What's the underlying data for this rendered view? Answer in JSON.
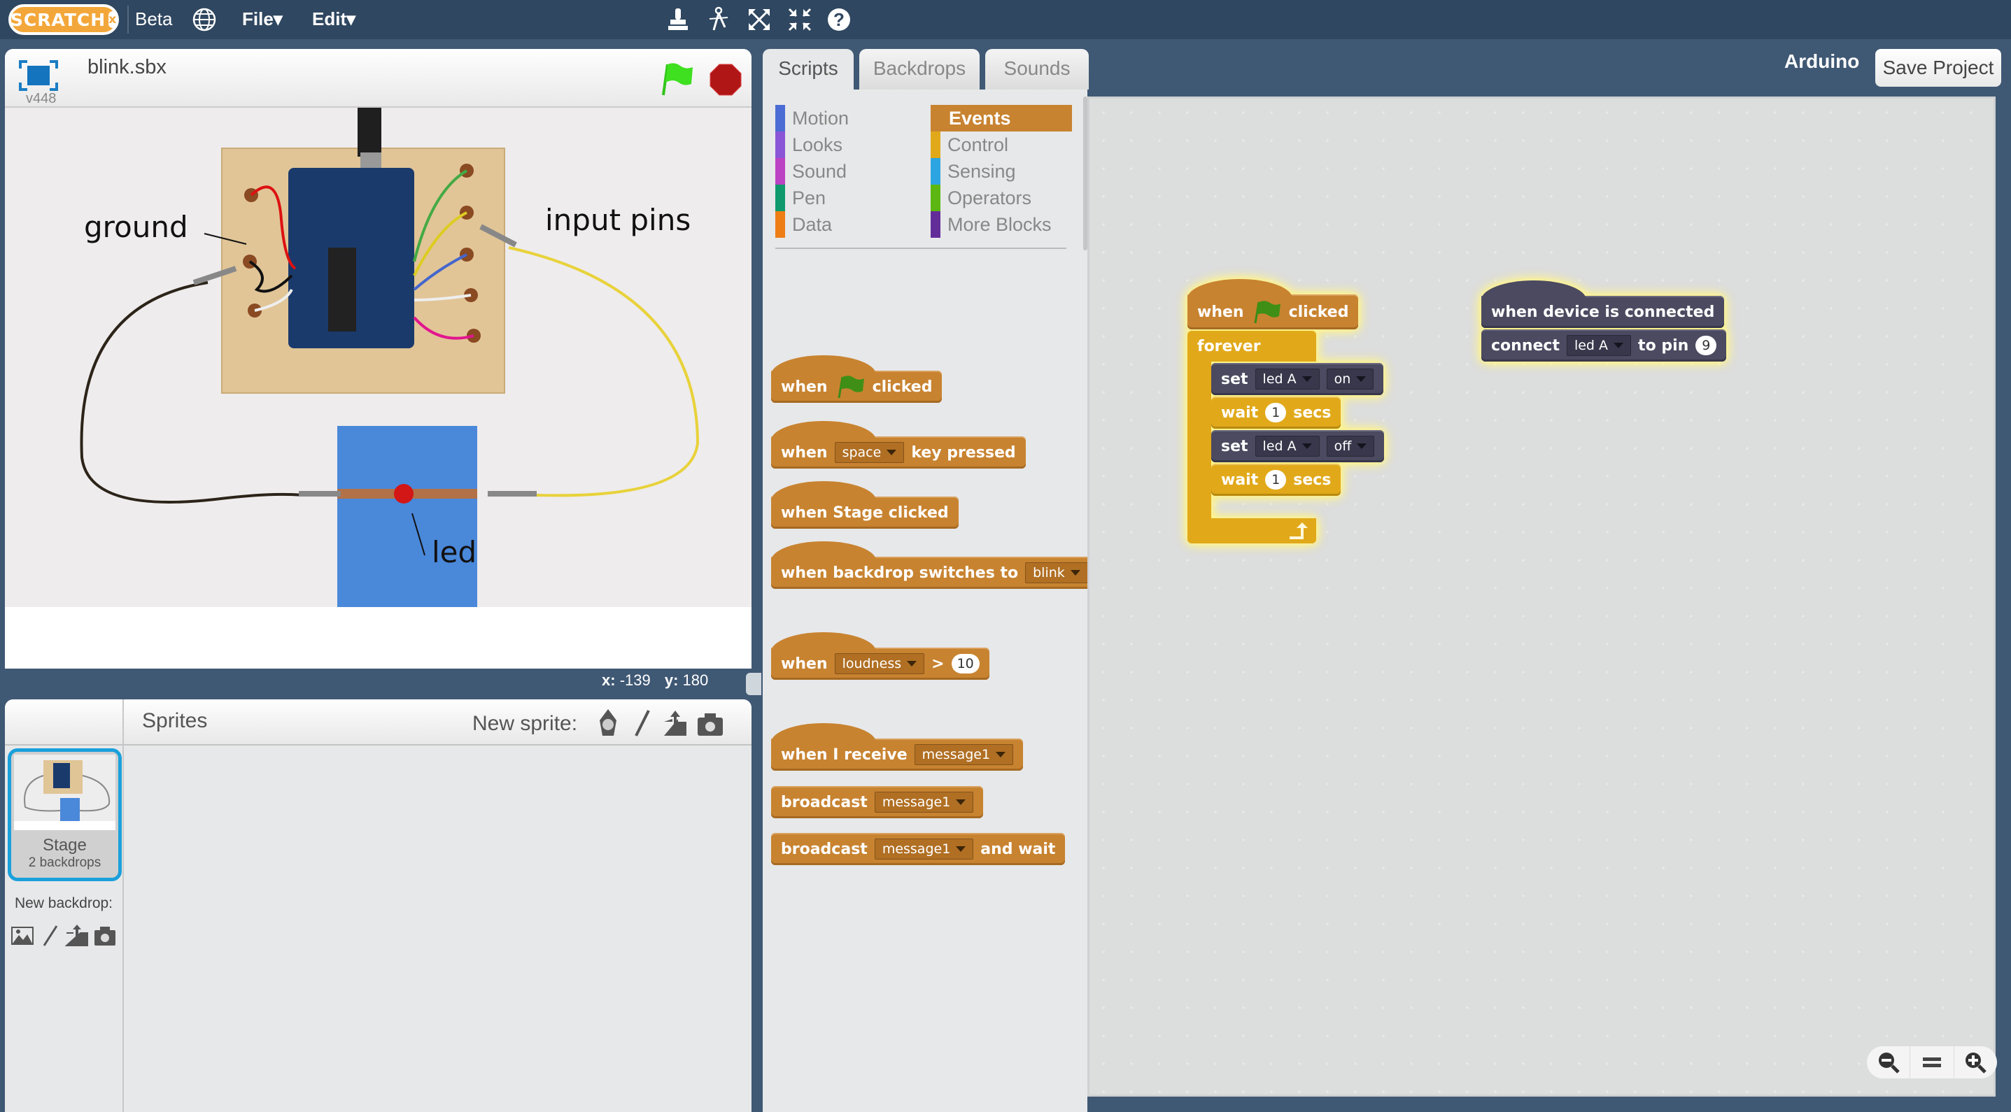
{
  "menubar": {
    "logo": "SCRATCH",
    "logo_badge": "x",
    "beta": "Beta",
    "file": "File▾",
    "edit": "Edit▾",
    "tools": [
      "duplicate-icon",
      "cut-icon",
      "grow-icon",
      "shrink-icon",
      "help-icon"
    ]
  },
  "stage": {
    "project_title": "blink.sbx",
    "version": "v448",
    "photo_labels": {
      "ground": "ground",
      "input_pins": "input pins",
      "led": "led"
    },
    "mouse_x_label": "x:",
    "mouse_x": "-139",
    "mouse_y_label": "y:",
    "mouse_y": "180"
  },
  "sprites": {
    "title": "Sprites",
    "new_sprite_label": "New sprite:",
    "stage_item": {
      "name": "Stage",
      "backdrops": "2 backdrops"
    },
    "new_backdrop_label": "New backdrop:"
  },
  "tabs": [
    {
      "label": "Scripts",
      "active": true
    },
    {
      "label": "Backdrops",
      "active": false
    },
    {
      "label": "Sounds",
      "active": false
    }
  ],
  "extension_name": "Arduino",
  "save_project": "Save Project",
  "categories_left": [
    {
      "label": "Motion",
      "color": "#4a6cd4"
    },
    {
      "label": "Looks",
      "color": "#8a55d7"
    },
    {
      "label": "Sound",
      "color": "#bb42c3"
    },
    {
      "label": "Pen",
      "color": "#0e9a6c"
    },
    {
      "label": "Data",
      "color": "#ee7d16"
    }
  ],
  "categories_right": [
    {
      "label": "Events",
      "color": "#c88330",
      "selected": true
    },
    {
      "label": "Control",
      "color": "#e1a91a"
    },
    {
      "label": "Sensing",
      "color": "#2ca5e2"
    },
    {
      "label": "Operators",
      "color": "#5cb712"
    },
    {
      "label": "More Blocks",
      "color": "#632d99"
    }
  ],
  "palette_blocks": {
    "flag_clicked": {
      "when": "when",
      "clicked": "clicked"
    },
    "key_pressed": {
      "when": "when",
      "key": "space",
      "rest": "key pressed"
    },
    "stage_clicked": {
      "text": "when Stage clicked"
    },
    "backdrop_switches": {
      "text": "when backdrop switches to",
      "value": "blink"
    },
    "loudness": {
      "when": "when",
      "sensor": "loudness",
      "op": ">",
      "value": "10"
    },
    "receive": {
      "text": "when I receive",
      "value": "message1"
    },
    "broadcast": {
      "text": "broadcast",
      "value": "message1"
    },
    "broadcast_wait": {
      "text": "broadcast",
      "value": "message1",
      "rest": "and wait"
    }
  },
  "script1": {
    "hat": {
      "when": "when",
      "clicked": "clicked"
    },
    "forever": "forever",
    "body": [
      {
        "type": "set",
        "label": "set",
        "device": "led A",
        "state": "on"
      },
      {
        "type": "wait",
        "label": "wait",
        "value": "1",
        "unit": "secs"
      },
      {
        "type": "set",
        "label": "set",
        "device": "led A",
        "state": "off"
      },
      {
        "type": "wait",
        "label": "wait",
        "value": "1",
        "unit": "secs"
      }
    ]
  },
  "script2": {
    "hat": "when device is connected",
    "connect": {
      "label": "connect",
      "device": "led A",
      "to": "to pin",
      "pin": "9"
    }
  },
  "zoom_controls": [
    "zoom-out-icon",
    "zoom-reset-icon",
    "zoom-in-icon"
  ]
}
